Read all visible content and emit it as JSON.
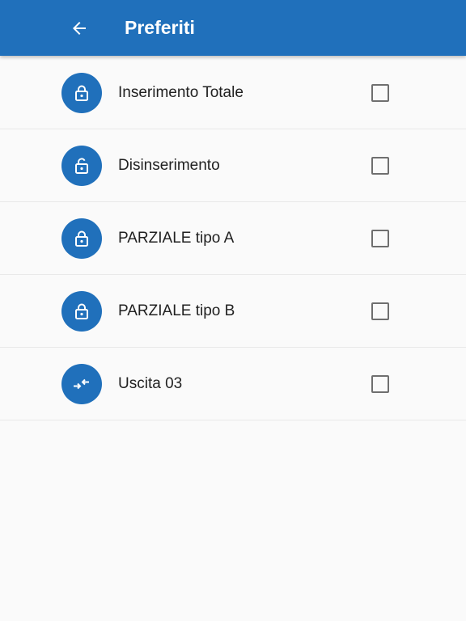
{
  "app_bar": {
    "title": "Preferiti",
    "back_icon": "arrow-back-icon",
    "color": "#2070bb"
  },
  "favorites": [
    {
      "label": "Inserimento Totale",
      "icon": "lock-icon",
      "checked": false
    },
    {
      "label": "Disinserimento",
      "icon": "lock-open-icon",
      "checked": false
    },
    {
      "label": "PARZIALE tipo A",
      "icon": "lock-icon",
      "checked": false
    },
    {
      "label": "PARZIALE tipo B",
      "icon": "lock-icon",
      "checked": false
    },
    {
      "label": "Uscita 03",
      "icon": "swap-arrows-icon",
      "checked": false
    }
  ],
  "colors": {
    "accent": "#2070bb",
    "background": "#fafafa",
    "text": "#212121",
    "checkbox_border": "#6f6f6f"
  }
}
